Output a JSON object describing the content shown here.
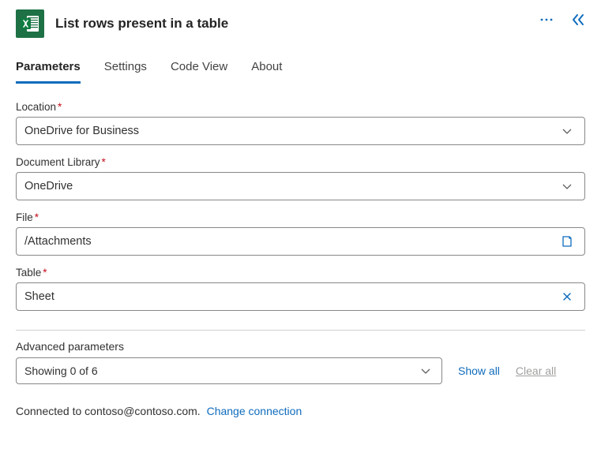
{
  "header": {
    "title": "List rows present in a table"
  },
  "tabs": [
    {
      "label": "Parameters",
      "active": true
    },
    {
      "label": "Settings",
      "active": false
    },
    {
      "label": "Code View",
      "active": false
    },
    {
      "label": "About",
      "active": false
    }
  ],
  "fields": {
    "location": {
      "label": "Location",
      "value": "OneDrive for Business"
    },
    "library": {
      "label": "Document Library",
      "value": "OneDrive"
    },
    "file": {
      "label": "File",
      "value": "/Attachments"
    },
    "table": {
      "label": "Table",
      "value": "Sheet"
    }
  },
  "advanced": {
    "label": "Advanced parameters",
    "summary": "Showing 0 of 6",
    "show_all": "Show all",
    "clear_all": "Clear all"
  },
  "footer": {
    "connected_prefix": "Connected to ",
    "account": "contoso@contoso.com.",
    "change": "Change connection"
  }
}
